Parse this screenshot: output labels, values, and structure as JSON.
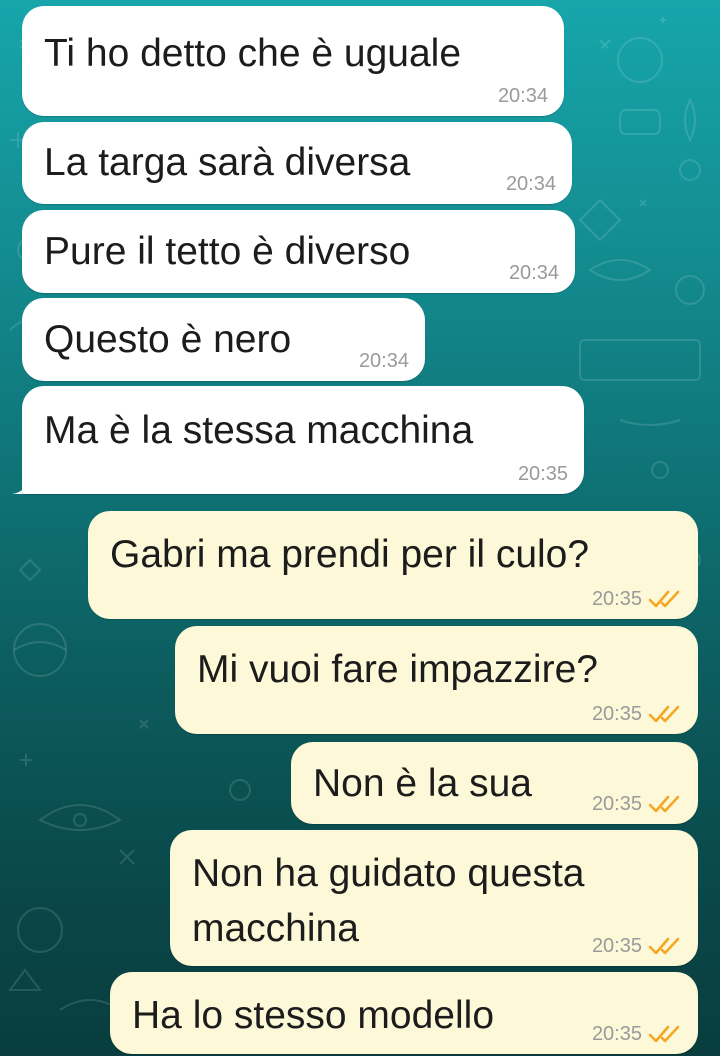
{
  "messages": [
    {
      "text": "Ti ho detto che è uguale",
      "time": "20:34",
      "direction": "incoming"
    },
    {
      "text": "La targa sarà diversa",
      "time": "20:34",
      "direction": "incoming"
    },
    {
      "text": "Pure il tetto è diverso",
      "time": "20:34",
      "direction": "incoming"
    },
    {
      "text": "Questo è nero",
      "time": "20:34",
      "direction": "incoming"
    },
    {
      "text": "Ma è la stessa macchina",
      "time": "20:35",
      "direction": "incoming"
    },
    {
      "text": "Gabri ma prendi per il culo?",
      "time": "20:35",
      "direction": "outgoing",
      "status": "read"
    },
    {
      "text": "Mi vuoi fare impazzire?",
      "time": "20:35",
      "direction": "outgoing",
      "status": "read"
    },
    {
      "text": "Non è la sua",
      "time": "20:35",
      "direction": "outgoing",
      "status": "read"
    },
    {
      "text_lines": [
        "Non ha guidato questa",
        "macchina"
      ],
      "time": "20:35",
      "direction": "outgoing",
      "status": "read"
    },
    {
      "text": "Ha lo stesso modello",
      "time": "20:35",
      "direction": "outgoing",
      "status": "read"
    }
  ],
  "icons": {
    "read_receipt": "double-check-icon"
  },
  "colors": {
    "incoming_bubble": "#ffffff",
    "outgoing_bubble": "#fdf8d8",
    "read_tick": "#f5a623",
    "background_top": "#16a6ab",
    "background_bottom": "#093d3e"
  }
}
